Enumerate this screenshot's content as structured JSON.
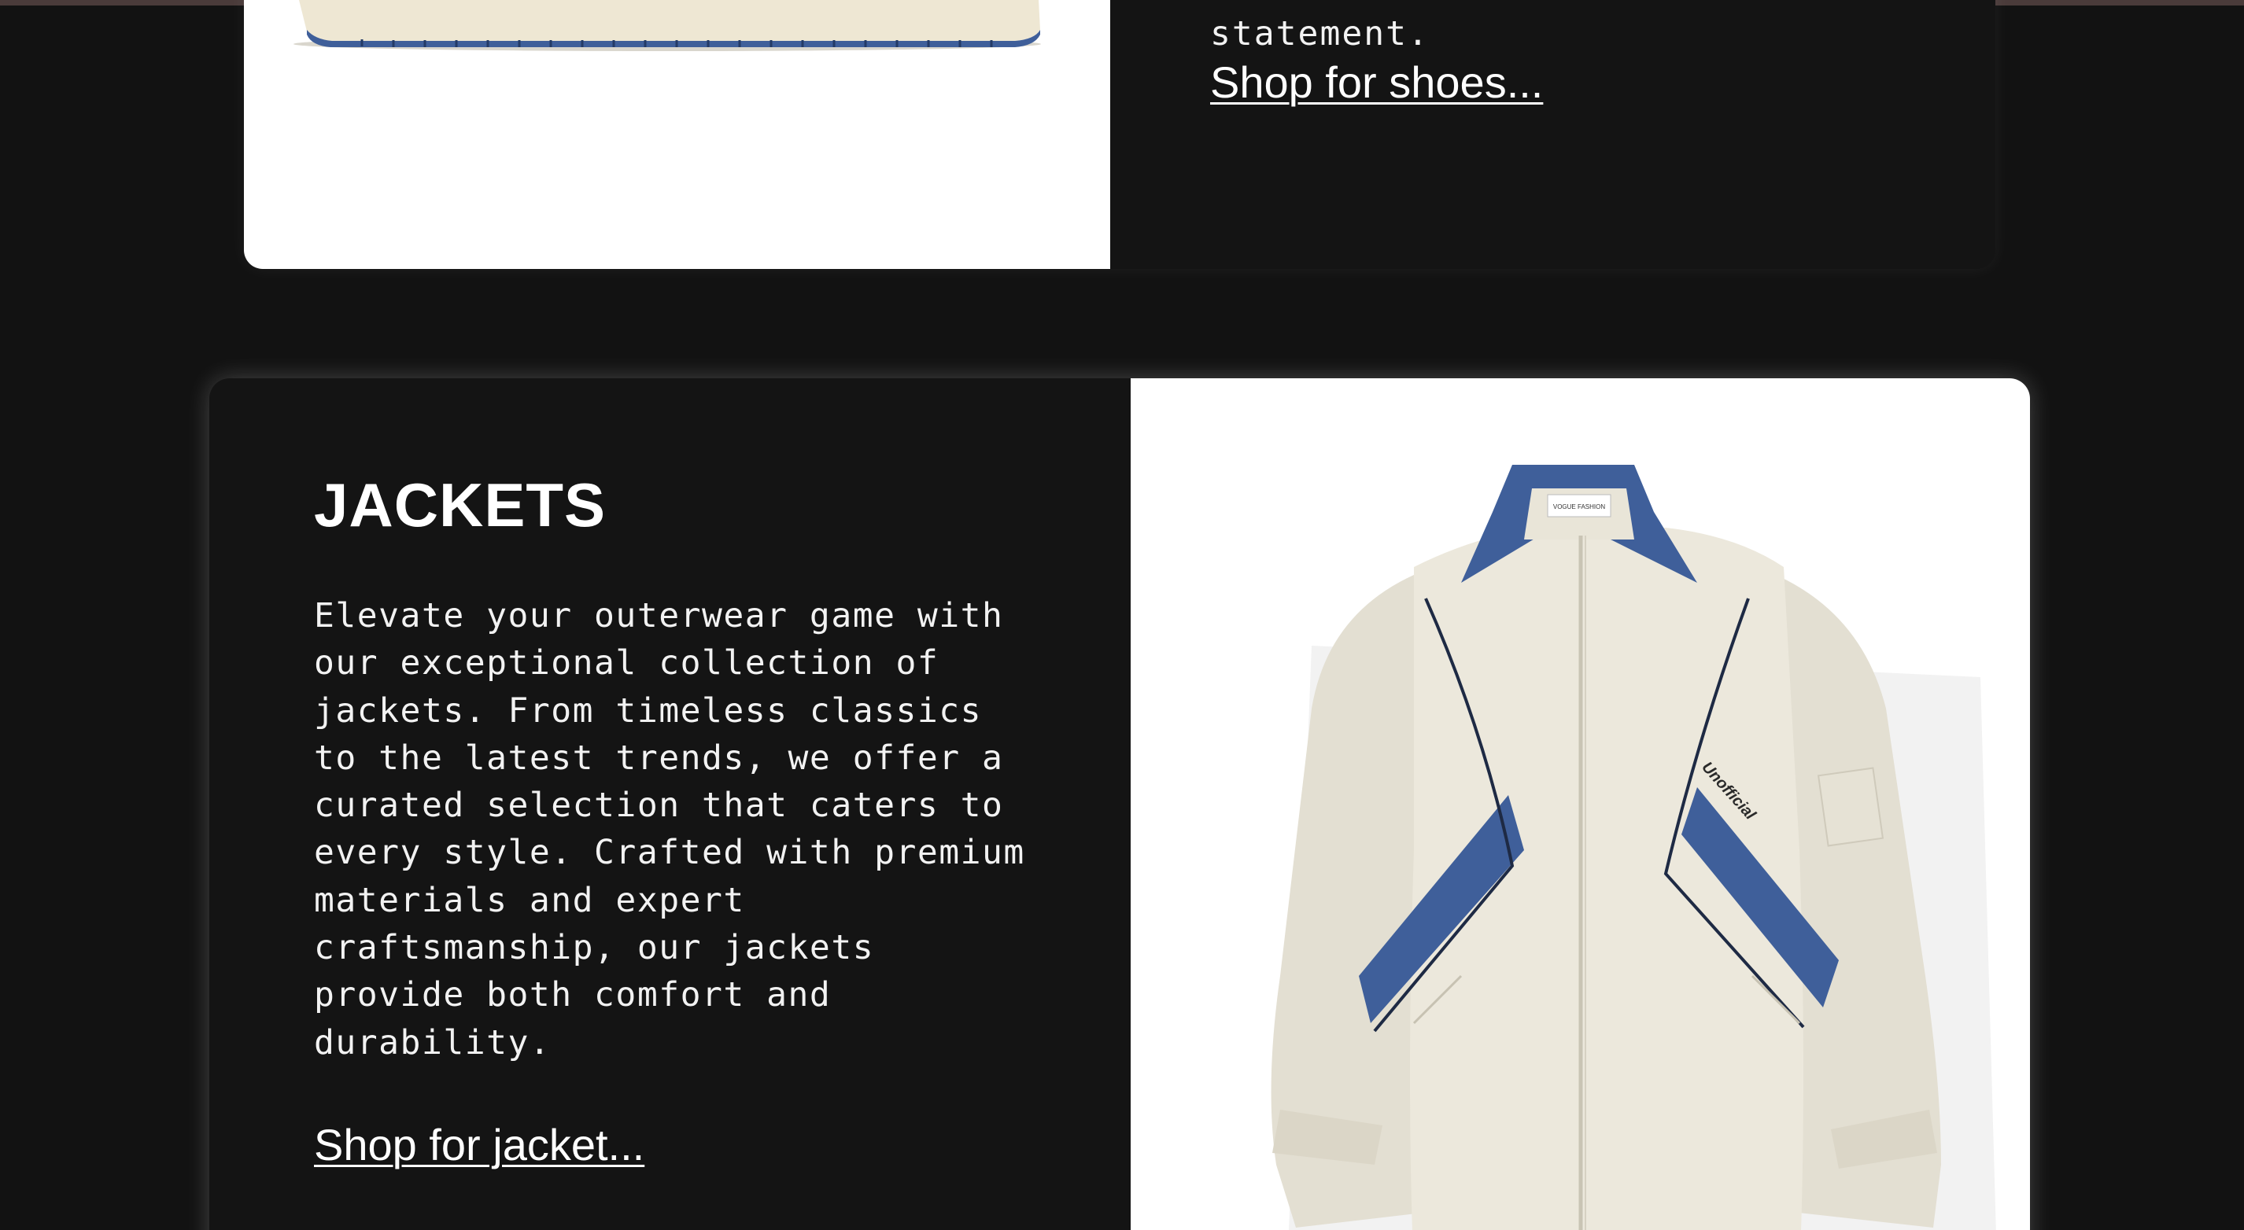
{
  "shoes_section": {
    "description_tail": "statement.",
    "link_text": "Shop for shoes..."
  },
  "jackets_section": {
    "title": "JACKETS",
    "description": "Elevate your outerwear game with our exceptional collection of jackets. From timeless classics to the latest trends, we offer a curated selection that caters to every style. Crafted with premium materials and expert craftsmanship, our jackets provide both comfort and durability.",
    "link_text": "Shop for jacket...",
    "image": {
      "print_text": "Unofficial",
      "collar_tag_text": "VOGUE FASHION"
    }
  },
  "colors": {
    "page_background": "#121212",
    "card_background": "#141414",
    "text": "#ffffff",
    "jacket_body": "#ece8dc",
    "jacket_accent": "#3f5f9a"
  }
}
